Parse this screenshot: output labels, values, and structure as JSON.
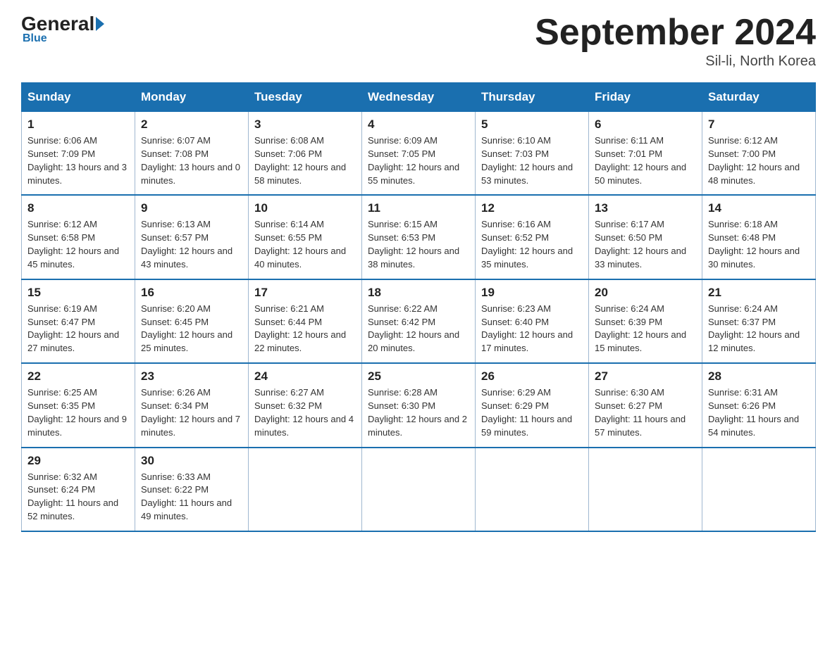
{
  "header": {
    "logo_general": "General",
    "logo_blue": "Blue",
    "logo_arrow": "►",
    "month_title": "September 2024",
    "location": "Sil-li, North Korea"
  },
  "weekdays": [
    "Sunday",
    "Monday",
    "Tuesday",
    "Wednesday",
    "Thursday",
    "Friday",
    "Saturday"
  ],
  "weeks": [
    [
      {
        "day": "1",
        "sunrise": "6:06 AM",
        "sunset": "7:09 PM",
        "daylight": "13 hours and 3 minutes."
      },
      {
        "day": "2",
        "sunrise": "6:07 AM",
        "sunset": "7:08 PM",
        "daylight": "13 hours and 0 minutes."
      },
      {
        "day": "3",
        "sunrise": "6:08 AM",
        "sunset": "7:06 PM",
        "daylight": "12 hours and 58 minutes."
      },
      {
        "day": "4",
        "sunrise": "6:09 AM",
        "sunset": "7:05 PM",
        "daylight": "12 hours and 55 minutes."
      },
      {
        "day": "5",
        "sunrise": "6:10 AM",
        "sunset": "7:03 PM",
        "daylight": "12 hours and 53 minutes."
      },
      {
        "day": "6",
        "sunrise": "6:11 AM",
        "sunset": "7:01 PM",
        "daylight": "12 hours and 50 minutes."
      },
      {
        "day": "7",
        "sunrise": "6:12 AM",
        "sunset": "7:00 PM",
        "daylight": "12 hours and 48 minutes."
      }
    ],
    [
      {
        "day": "8",
        "sunrise": "6:12 AM",
        "sunset": "6:58 PM",
        "daylight": "12 hours and 45 minutes."
      },
      {
        "day": "9",
        "sunrise": "6:13 AM",
        "sunset": "6:57 PM",
        "daylight": "12 hours and 43 minutes."
      },
      {
        "day": "10",
        "sunrise": "6:14 AM",
        "sunset": "6:55 PM",
        "daylight": "12 hours and 40 minutes."
      },
      {
        "day": "11",
        "sunrise": "6:15 AM",
        "sunset": "6:53 PM",
        "daylight": "12 hours and 38 minutes."
      },
      {
        "day": "12",
        "sunrise": "6:16 AM",
        "sunset": "6:52 PM",
        "daylight": "12 hours and 35 minutes."
      },
      {
        "day": "13",
        "sunrise": "6:17 AM",
        "sunset": "6:50 PM",
        "daylight": "12 hours and 33 minutes."
      },
      {
        "day": "14",
        "sunrise": "6:18 AM",
        "sunset": "6:48 PM",
        "daylight": "12 hours and 30 minutes."
      }
    ],
    [
      {
        "day": "15",
        "sunrise": "6:19 AM",
        "sunset": "6:47 PM",
        "daylight": "12 hours and 27 minutes."
      },
      {
        "day": "16",
        "sunrise": "6:20 AM",
        "sunset": "6:45 PM",
        "daylight": "12 hours and 25 minutes."
      },
      {
        "day": "17",
        "sunrise": "6:21 AM",
        "sunset": "6:44 PM",
        "daylight": "12 hours and 22 minutes."
      },
      {
        "day": "18",
        "sunrise": "6:22 AM",
        "sunset": "6:42 PM",
        "daylight": "12 hours and 20 minutes."
      },
      {
        "day": "19",
        "sunrise": "6:23 AM",
        "sunset": "6:40 PM",
        "daylight": "12 hours and 17 minutes."
      },
      {
        "day": "20",
        "sunrise": "6:24 AM",
        "sunset": "6:39 PM",
        "daylight": "12 hours and 15 minutes."
      },
      {
        "day": "21",
        "sunrise": "6:24 AM",
        "sunset": "6:37 PM",
        "daylight": "12 hours and 12 minutes."
      }
    ],
    [
      {
        "day": "22",
        "sunrise": "6:25 AM",
        "sunset": "6:35 PM",
        "daylight": "12 hours and 9 minutes."
      },
      {
        "day": "23",
        "sunrise": "6:26 AM",
        "sunset": "6:34 PM",
        "daylight": "12 hours and 7 minutes."
      },
      {
        "day": "24",
        "sunrise": "6:27 AM",
        "sunset": "6:32 PM",
        "daylight": "12 hours and 4 minutes."
      },
      {
        "day": "25",
        "sunrise": "6:28 AM",
        "sunset": "6:30 PM",
        "daylight": "12 hours and 2 minutes."
      },
      {
        "day": "26",
        "sunrise": "6:29 AM",
        "sunset": "6:29 PM",
        "daylight": "11 hours and 59 minutes."
      },
      {
        "day": "27",
        "sunrise": "6:30 AM",
        "sunset": "6:27 PM",
        "daylight": "11 hours and 57 minutes."
      },
      {
        "day": "28",
        "sunrise": "6:31 AM",
        "sunset": "6:26 PM",
        "daylight": "11 hours and 54 minutes."
      }
    ],
    [
      {
        "day": "29",
        "sunrise": "6:32 AM",
        "sunset": "6:24 PM",
        "daylight": "11 hours and 52 minutes."
      },
      {
        "day": "30",
        "sunrise": "6:33 AM",
        "sunset": "6:22 PM",
        "daylight": "11 hours and 49 minutes."
      },
      null,
      null,
      null,
      null,
      null
    ]
  ]
}
